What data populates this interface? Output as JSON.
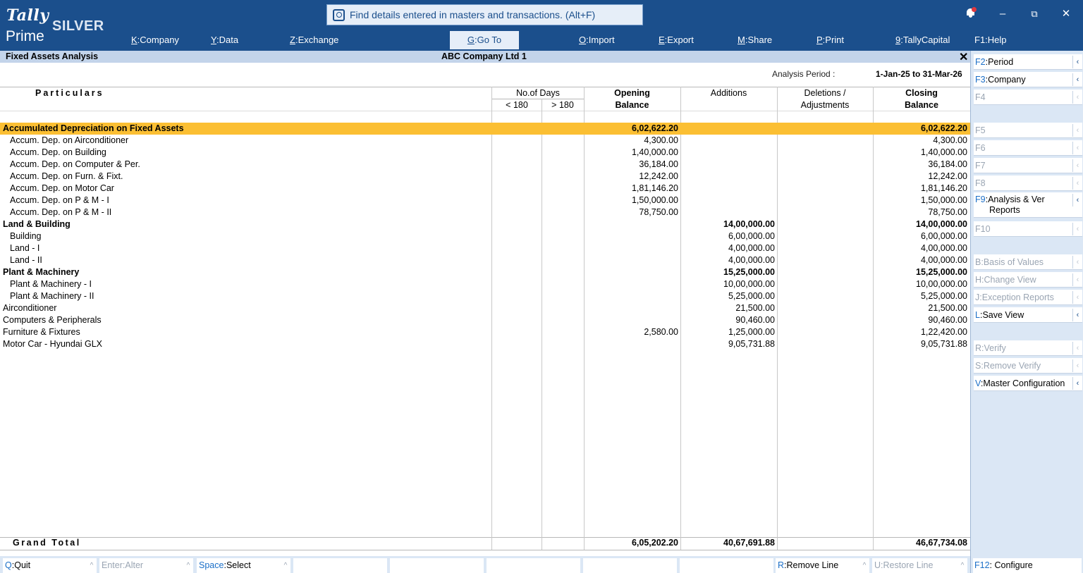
{
  "brand": {
    "tally": "Tally",
    "silver": "SILVER",
    "prime": "Prime"
  },
  "search": {
    "placeholder": "Find details entered in masters and transactions. (Alt+F)"
  },
  "window": {
    "minimize": "–",
    "restore": "⧉",
    "close": "✕"
  },
  "menu": [
    {
      "key": "K",
      "label": "Company"
    },
    {
      "key": "Y",
      "label": "Data"
    },
    {
      "key": "Z",
      "label": "Exchange"
    },
    {
      "key": "G",
      "label": "Go To"
    },
    {
      "key": "O",
      "label": "Import"
    },
    {
      "key": "E",
      "label": "Export"
    },
    {
      "key": "M",
      "label": "Share"
    },
    {
      "key": "P",
      "label": "Print"
    },
    {
      "key": "9",
      "label": "TallyCapital"
    },
    {
      "key": "F1",
      "label": "Help"
    }
  ],
  "titlebar": {
    "report": "Fixed Assets Analysis",
    "company": "ABC Company Ltd 1",
    "close": "✕"
  },
  "period": {
    "label": "Analysis Period :",
    "value": "1-Jan-25 to 31-Mar-26"
  },
  "headers": {
    "particulars": "Particulars",
    "days": "No.of Days",
    "lt180": "< 180",
    "gt180": "> 180",
    "opening1": "Opening",
    "opening2": "Balance",
    "additions": "Additions",
    "deletions1": "Deletions /",
    "deletions2": "Adjustments",
    "closing1": "Closing",
    "closing2": "Balance"
  },
  "rows": [
    {
      "name": "Accumulated Depreciation on Fixed Assets",
      "opening": "6,02,622.20",
      "additions": "",
      "closing": "6,02,622.20",
      "type": "highlight"
    },
    {
      "name": "Accum. Dep. on Airconditioner",
      "opening": "4,300.00",
      "additions": "",
      "closing": "4,300.00",
      "type": "sub"
    },
    {
      "name": "Accum. Dep. on Building",
      "opening": "1,40,000.00",
      "additions": "",
      "closing": "1,40,000.00",
      "type": "sub"
    },
    {
      "name": "Accum. Dep. on Computer & Per.",
      "opening": "36,184.00",
      "additions": "",
      "closing": "36,184.00",
      "type": "sub"
    },
    {
      "name": "Accum. Dep. on Furn. & Fixt.",
      "opening": "12,242.00",
      "additions": "",
      "closing": "12,242.00",
      "type": "sub"
    },
    {
      "name": "Accum. Dep. on Motor Car",
      "opening": "1,81,146.20",
      "additions": "",
      "closing": "1,81,146.20",
      "type": "sub"
    },
    {
      "name": "Accum. Dep. on P & M - I",
      "opening": "1,50,000.00",
      "additions": "",
      "closing": "1,50,000.00",
      "type": "sub"
    },
    {
      "name": "Accum. Dep. on P & M - II",
      "opening": "78,750.00",
      "additions": "",
      "closing": "78,750.00",
      "type": "sub"
    },
    {
      "name": "Land & Building",
      "opening": "",
      "additions": "14,00,000.00",
      "closing": "14,00,000.00",
      "type": "group"
    },
    {
      "name": "Building",
      "opening": "",
      "additions": "6,00,000.00",
      "closing": "6,00,000.00",
      "type": "sub"
    },
    {
      "name": "Land - I",
      "opening": "",
      "additions": "4,00,000.00",
      "closing": "4,00,000.00",
      "type": "sub"
    },
    {
      "name": "Land - II",
      "opening": "",
      "additions": "4,00,000.00",
      "closing": "4,00,000.00",
      "type": "sub"
    },
    {
      "name": "Plant & Machinery",
      "opening": "",
      "additions": "15,25,000.00",
      "closing": "15,25,000.00",
      "type": "group"
    },
    {
      "name": "Plant & Machinery - I",
      "opening": "",
      "additions": "10,00,000.00",
      "closing": "10,00,000.00",
      "type": "sub"
    },
    {
      "name": "Plant & Machinery - II",
      "opening": "",
      "additions": "5,25,000.00",
      "closing": "5,25,000.00",
      "type": "sub"
    },
    {
      "name": "Airconditioner",
      "opening": "",
      "additions": "21,500.00",
      "closing": "21,500.00",
      "type": "plain"
    },
    {
      "name": "Computers & Peripherals",
      "opening": "",
      "additions": "90,460.00",
      "closing": "90,460.00",
      "type": "plain"
    },
    {
      "name": "Furniture & Fixtures",
      "opening": "2,580.00",
      "additions": "1,25,000.00",
      "closing": "1,22,420.00",
      "type": "plain"
    },
    {
      "name": "Motor Car - Hyundai GLX",
      "opening": "",
      "additions": "9,05,731.88",
      "closing": "9,05,731.88",
      "type": "plain"
    }
  ],
  "grand_total": {
    "label": "Grand Total",
    "opening": "6,05,202.20",
    "additions": "40,67,691.88",
    "closing": "46,67,734.08"
  },
  "right_panel": [
    {
      "key": "F2",
      "label": "Period",
      "enabled": true
    },
    {
      "key": "F3",
      "label": "Company",
      "enabled": true
    },
    {
      "key": "F4",
      "label": "",
      "enabled": false
    },
    {
      "key": "F5",
      "label": "",
      "enabled": false
    },
    {
      "key": "F6",
      "label": "",
      "enabled": false
    },
    {
      "key": "F7",
      "label": "",
      "enabled": false
    },
    {
      "key": "F8",
      "label": "",
      "enabled": false
    },
    {
      "key": "F9",
      "label": "Analysis & Ver",
      "label2": "Reports",
      "enabled": true
    },
    {
      "key": "F10",
      "label": "",
      "enabled": false
    },
    {
      "key": "B",
      "label": "Basis of Values",
      "enabled": false
    },
    {
      "key": "H",
      "label": "Change View",
      "enabled": false
    },
    {
      "key": "J",
      "label": "Exception Reports",
      "enabled": false
    },
    {
      "key": "L",
      "label": "Save View",
      "enabled": true
    },
    {
      "key": "R",
      "label": "Verify",
      "enabled": false
    },
    {
      "key": "S",
      "label": "Remove Verify",
      "enabled": false
    },
    {
      "key": "V",
      "label": "Master Configuration",
      "enabled": true
    }
  ],
  "bottom_bar": [
    {
      "key": "Q",
      "label": "Quit",
      "enabled": true
    },
    {
      "key": "Enter",
      "label": "Alter",
      "enabled": false
    },
    {
      "key": "Space",
      "label": "Select",
      "enabled": true
    },
    {
      "key": "R",
      "label": "Remove Line",
      "enabled": true
    },
    {
      "key": "U",
      "label": "Restore Line",
      "enabled": false
    }
  ],
  "f12": {
    "key": "F12",
    "label": "Configure"
  },
  "colors": {
    "brand_blue": "#1b4f8c",
    "highlight": "#fbbf33",
    "key_blue": "#1b6fc8",
    "panel_bg": "#dbe7f5"
  }
}
